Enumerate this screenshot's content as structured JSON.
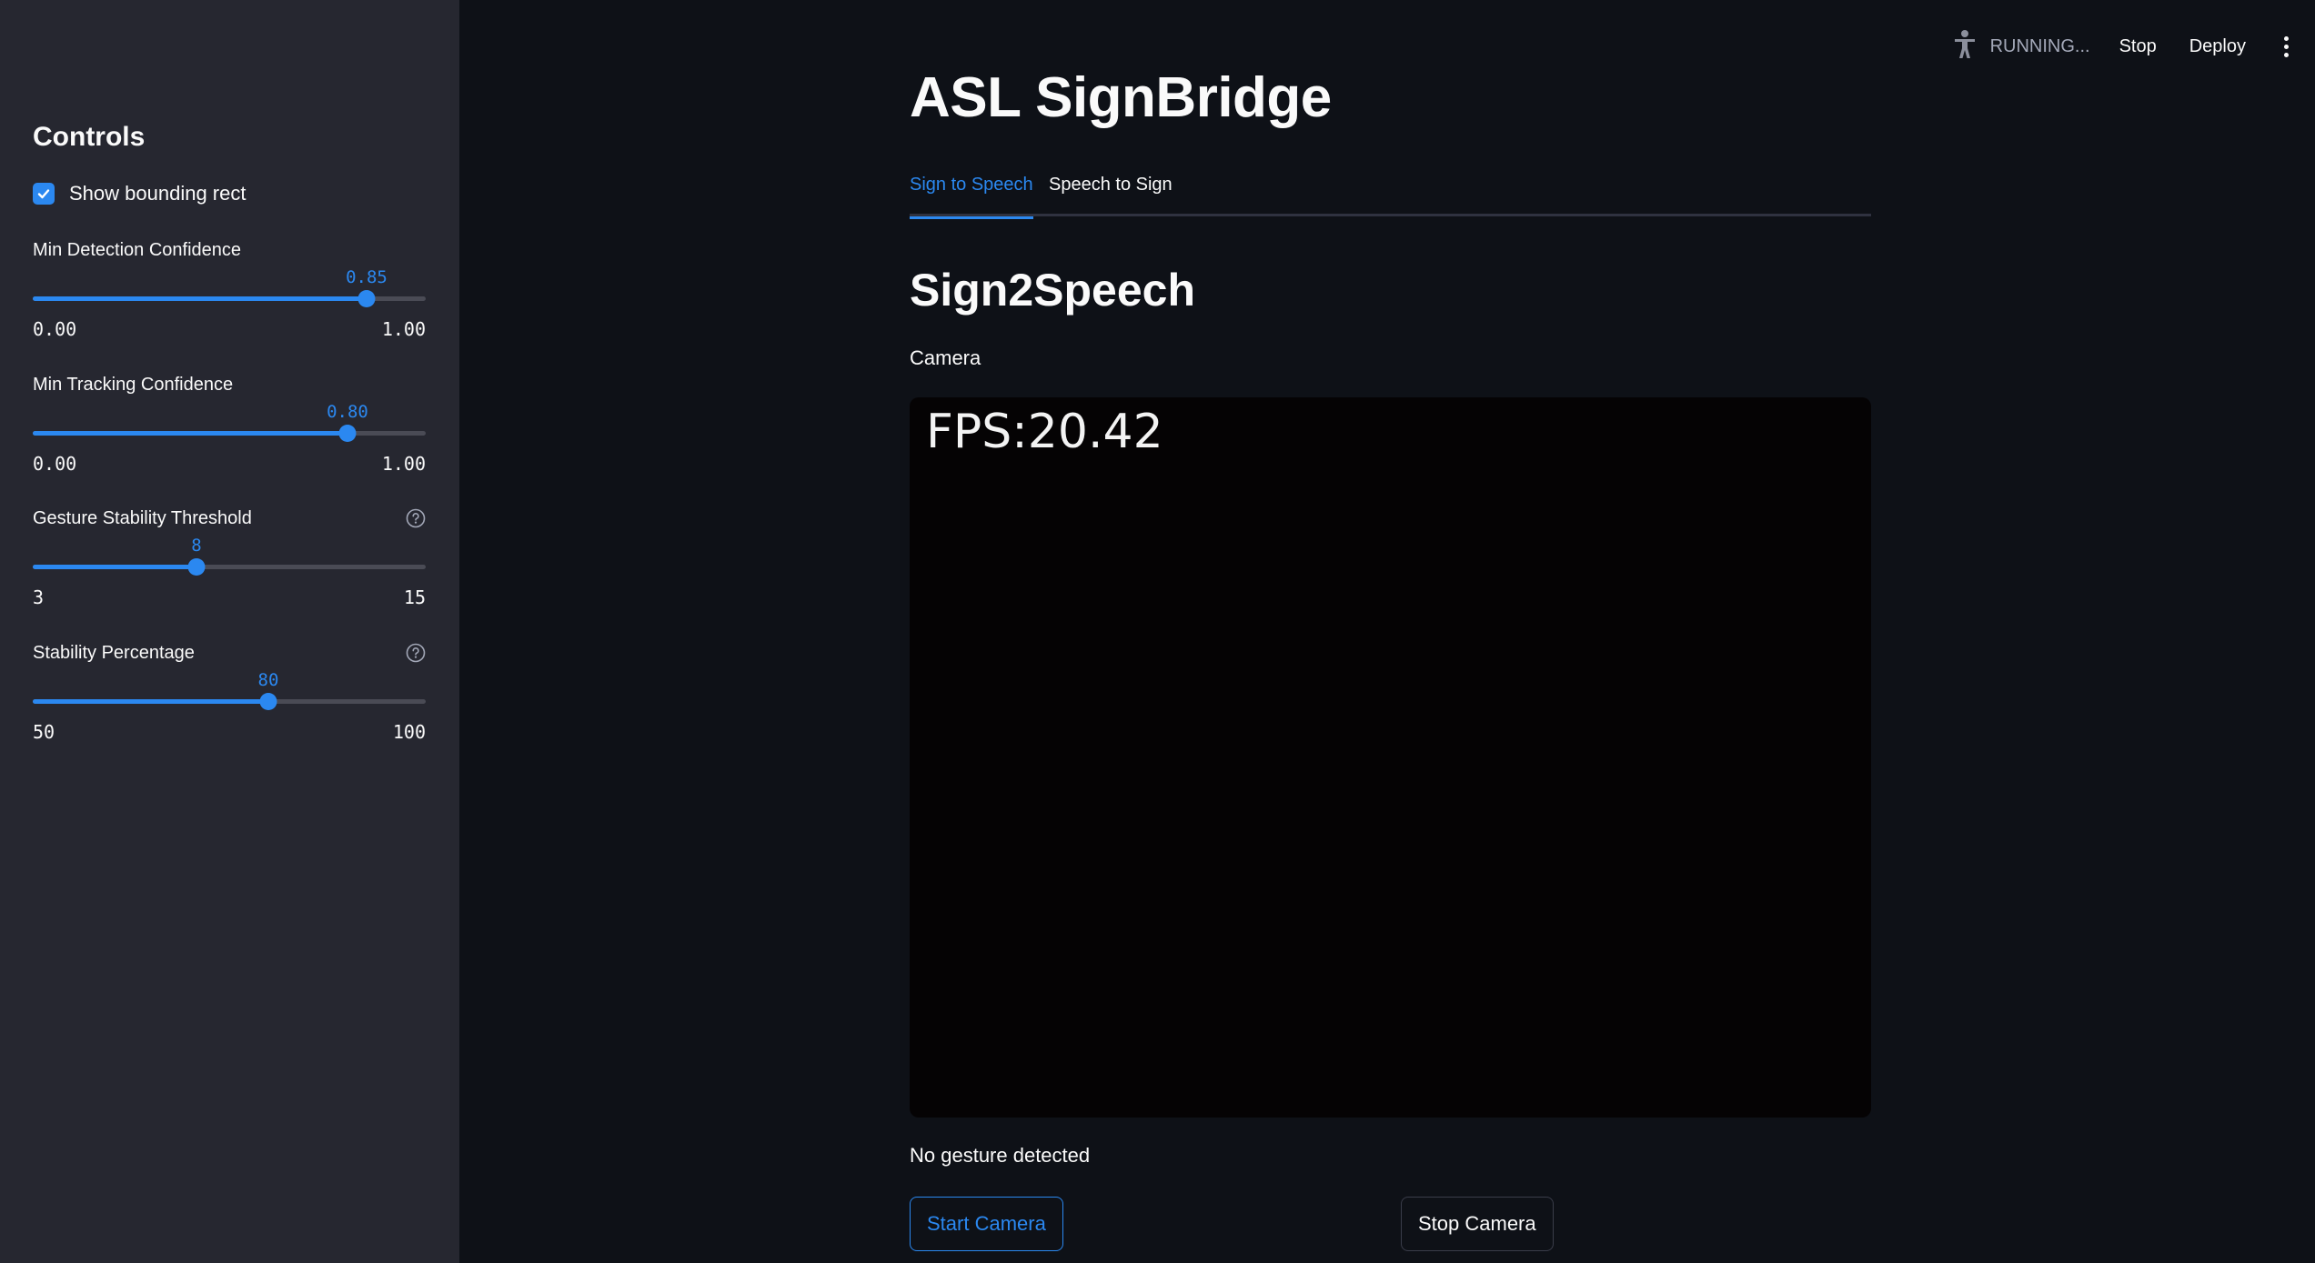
{
  "sidebar": {
    "title": "Controls",
    "checkbox": {
      "label": "Show bounding rect",
      "checked": true
    },
    "sliders": [
      {
        "label": "Min Detection Confidence",
        "value": "0.85",
        "min": "0.00",
        "max": "1.00",
        "fraction": 0.85,
        "help": false
      },
      {
        "label": "Min Tracking Confidence",
        "value": "0.80",
        "min": "0.00",
        "max": "1.00",
        "fraction": 0.8,
        "help": false
      },
      {
        "label": "Gesture Stability Threshold",
        "value": "8",
        "min": "3",
        "max": "15",
        "fraction": 0.4167,
        "help": true
      },
      {
        "label": "Stability Percentage",
        "value": "80",
        "min": "50",
        "max": "100",
        "fraction": 0.6,
        "help": true
      }
    ]
  },
  "header": {
    "status": "RUNNING...",
    "stop_label": "Stop",
    "deploy_label": "Deploy"
  },
  "main": {
    "title": "ASL SignBridge",
    "tabs": [
      {
        "label": "Sign to Speech",
        "active": true
      },
      {
        "label": "Speech to Sign",
        "active": false
      }
    ],
    "section_title": "Sign2Speech",
    "camera_label": "Camera",
    "fps_overlay": "FPS:20.42",
    "status": "No gesture detected",
    "start_button": "Start Camera",
    "stop_button": "Stop Camera"
  },
  "colors": {
    "accent": "#2b88f0",
    "background": "#0e1117",
    "sidebar": "#262730"
  }
}
